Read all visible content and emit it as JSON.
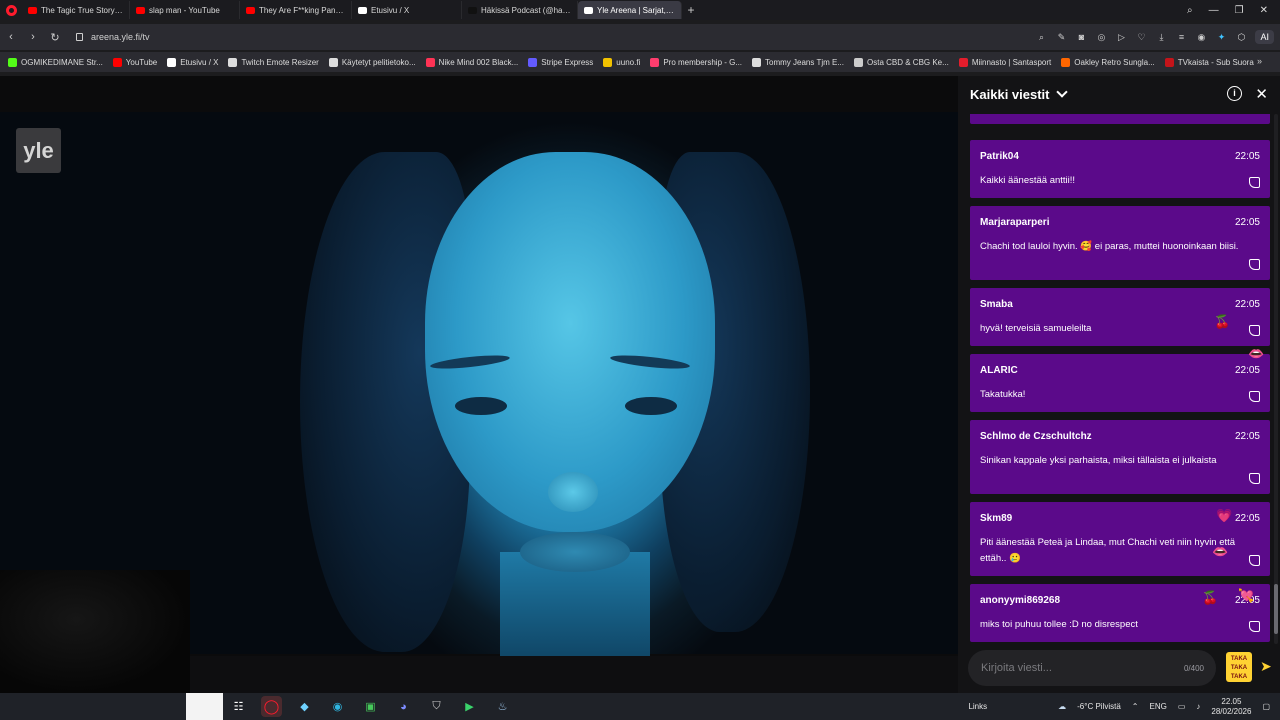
{
  "tabs": [
    {
      "label": "The Tagic True Story of Ju",
      "color": "#ff0000"
    },
    {
      "label": "slap man - YouTube",
      "color": "#ff0000"
    },
    {
      "label": "They Are F**king Panickin",
      "color": "#ff0000"
    },
    {
      "label": "Etusivu / X",
      "color": "#ffffff"
    },
    {
      "label": "Häkissä Podcast (@hakiss",
      "color": "#111111"
    },
    {
      "label": "Yle Areena | Sarjat, Po",
      "color": "#ffffff",
      "active": true
    }
  ],
  "address": {
    "url": "areena.yle.fi/tv",
    "ai_label": "AI"
  },
  "bookmarks": [
    {
      "label": "OGMIKEDIMANE Str...",
      "color": "#53fc18"
    },
    {
      "label": "YouTube",
      "color": "#ff0000"
    },
    {
      "label": "Etusivu / X",
      "color": "#ffffff"
    },
    {
      "label": "Twitch Emote Resizer",
      "color": "#dddddd"
    },
    {
      "label": "Käytetyt pelitietoko...",
      "color": "#dddddd"
    },
    {
      "label": "Nike Mind 002 Black...",
      "color": "#ff3355"
    },
    {
      "label": "Stripe Express",
      "color": "#635bff"
    },
    {
      "label": "uuno.fi",
      "color": "#f2c200"
    },
    {
      "label": "Pro membership - G...",
      "color": "#ff3d6e"
    },
    {
      "label": "Tommy Jeans Tjm E...",
      "color": "#dddddd"
    },
    {
      "label": "Osta CBD & CBG Ke...",
      "color": "#cccccc"
    },
    {
      "label": "Miinnasto | Santasport",
      "color": "#e31d2c"
    },
    {
      "label": "Oakley Retro Sungla...",
      "color": "#ff6600"
    },
    {
      "label": "TVkaista - Sub Suora",
      "color": "#c4141a"
    }
  ],
  "video": {
    "logo": "yle"
  },
  "chat": {
    "title": "Kaikki viestit",
    "input_placeholder": "Kirjoita viesti...",
    "char_count": "0/400",
    "reaction_label": "TAKA TAKA TAKA",
    "messages": [
      {
        "user": "",
        "time": "",
        "text": "",
        "partial": true
      },
      {
        "user": "Patrik04",
        "time": "22:05",
        "text": "Kaikki äänestää anttii!!"
      },
      {
        "user": "Marjaraparperi",
        "time": "22:05",
        "text": "Chachi tod lauloi hyvin. 🥰 ei paras, muttei huonoinkaan biisi."
      },
      {
        "user": "Smaba",
        "time": "22:05",
        "text": "hyvä! terveisiä samueleilta"
      },
      {
        "user": "ALARIC",
        "time": "22:05",
        "text": "Takatukka!"
      },
      {
        "user": "Schlmo de Czschultchz",
        "time": "22:05",
        "text": "Sinikan kappale yksi parhaista, miksi tällaista ei julkaista"
      },
      {
        "user": "Skm89",
        "time": "22:05",
        "text": "Piti äänestää Peteä ja Lindaa, mut Chachi veti niin hyvin että ettäh.. 🥲"
      },
      {
        "user": "anonyymi869268",
        "time": "22:05",
        "text": "miks toi puhuu tollee :D no disrespect"
      }
    ]
  },
  "taskbar": {
    "links_label": "Links",
    "weather": "-6°C  Pilvistä",
    "language": "ENG",
    "time": "22.05",
    "date": "28/02/2026"
  }
}
